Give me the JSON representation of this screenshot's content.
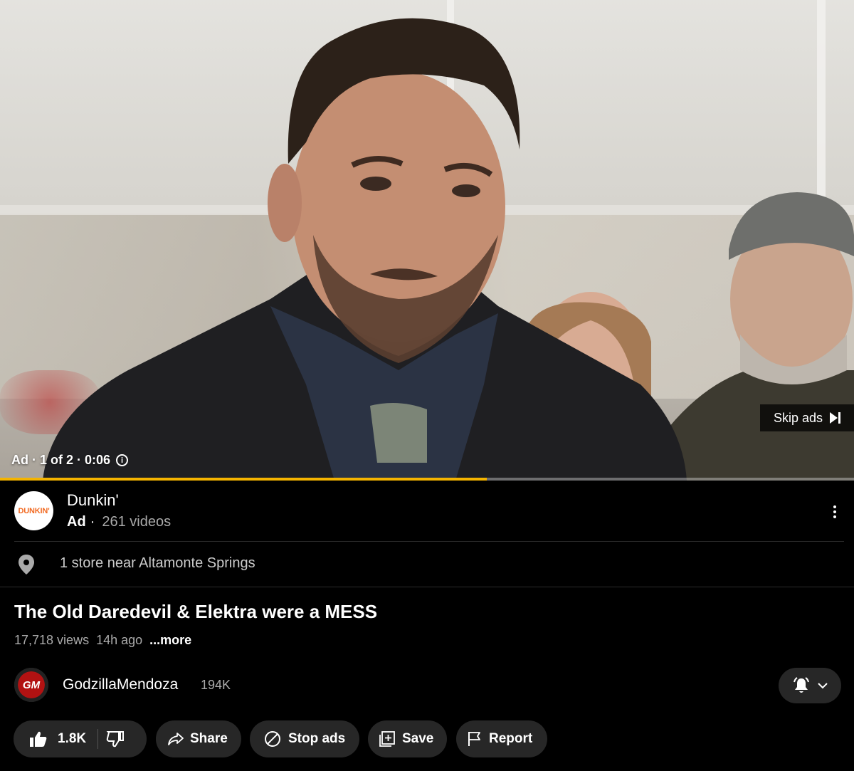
{
  "player": {
    "ad_info": "Ad · 1 of 2 · 0:06",
    "info_icon": "info-icon",
    "skip_label": "Skip ads",
    "progress": 0.57,
    "progress_color": "#f4b400"
  },
  "advertiser": {
    "logo_text": "DUNKIN'",
    "name": "Dunkin'",
    "ad_tag": "Ad",
    "separator": "·",
    "video_count": "261 videos",
    "location_text": "1 store near Altamonte Springs"
  },
  "video": {
    "title": "The Old Daredevil & Elektra were a MESS",
    "views": "17,718 views",
    "age": "14h ago",
    "more_label": "...more"
  },
  "channel": {
    "avatar_text": "GM",
    "name": "GodzillaMendoza",
    "subscribers": "194K"
  },
  "actions": {
    "like_count": "1.8K",
    "share_label": "Share",
    "stop_ads_label": "Stop ads",
    "save_label": "Save",
    "report_label": "Report"
  },
  "colors": {
    "background": "#000000",
    "pill": "#272727",
    "secondary_text": "#aaaaaa",
    "dunkin_orange": "#f26a22",
    "channel_red": "#b21212"
  }
}
